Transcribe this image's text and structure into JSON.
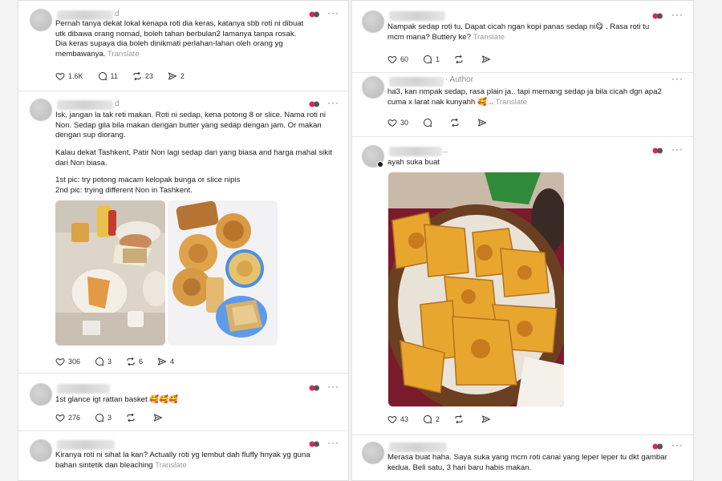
{
  "left": {
    "posts": [
      {
        "handle_suffix": "d",
        "text": "Pernah tanya dekat lokal kenapa roti dia keras, katanya sbb roti ni dibuat\nutk dibawa orang nomad, boleh tahan berbulan2 lamanya tanpa rosak.\nDia keras supaya dia boleh dinikmati perlahan-lahan oleh orang yg\nmembawanya.",
        "translate": "Translate",
        "likes": "1.6K",
        "replies": "11",
        "reposts": "23",
        "shares": "2"
      },
      {
        "handle_suffix": "d",
        "text": "Isk, jangan la tak reti makan. Roti ni sedap, kena potong 8 or slice. Nama roti ni\nNon. Sedap gila bila makan dengan butter yang sedap dengan jam. Or makan\ndengan sup diorang.",
        "text2": "Kalau dekat Tashkent, Patir Non lagi sedap dari yang biasa and harga mahal sikit\ndari Non biasa.",
        "text3": "1st pic: try potong macam kelopak bunga or slice nipis\n2nd pic: trying different Non in Tashkent.",
        "likes": "306",
        "replies": "3",
        "reposts": "6",
        "shares": "4"
      },
      {
        "text": "1st glance igt rattan basket 🥰🥰🥰",
        "likes": "276",
        "replies": "3",
        "reposts": "",
        "shares": ""
      },
      {
        "text": "Kiranya roti ni sihat la kan? Actually roti yg lembut dah fluffy hnyak yg guna\nbahan sintetik dan bleaching",
        "translate": "Translate"
      }
    ]
  },
  "right": {
    "posts": [
      {
        "text": "Nampak sedap roti tu. Dapat cicah ngan kopi panas sedap ni😋 . Rasa roti tu\nmcm mana? Buttery ke?",
        "translate": "Translate",
        "likes": "60",
        "replies": "1"
      },
      {
        "author_label": "· Author",
        "text": "ha3, kan nmpak sedap, rasa plain ja.. tapi memang sedap ja bila cicah dgn apa2\ncuma x larat nak kunyahh 🥰 ..",
        "translate": "Translate",
        "likes": "30"
      },
      {
        "handle_suffix": "_",
        "text": "ayah suka buat",
        "likes": "43",
        "replies": "2"
      },
      {
        "text": "Merasa buat haha. Saya suka yang mcm roti canai yang leper leper tu dkt gambar\nkedua. Beli satu, 3 hari baru habis makan."
      }
    ]
  },
  "icons": {
    "more": "more-icon",
    "heart": "heart-icon",
    "reply": "reply-icon",
    "repost": "repost-icon",
    "share": "share-icon",
    "reaction": "reaction-emoji-icon"
  },
  "colors": {
    "text": "#1c1c1c",
    "muted": "#9a9a9a",
    "border": "#e6e6e6",
    "reaction_red": "#e0245e"
  }
}
